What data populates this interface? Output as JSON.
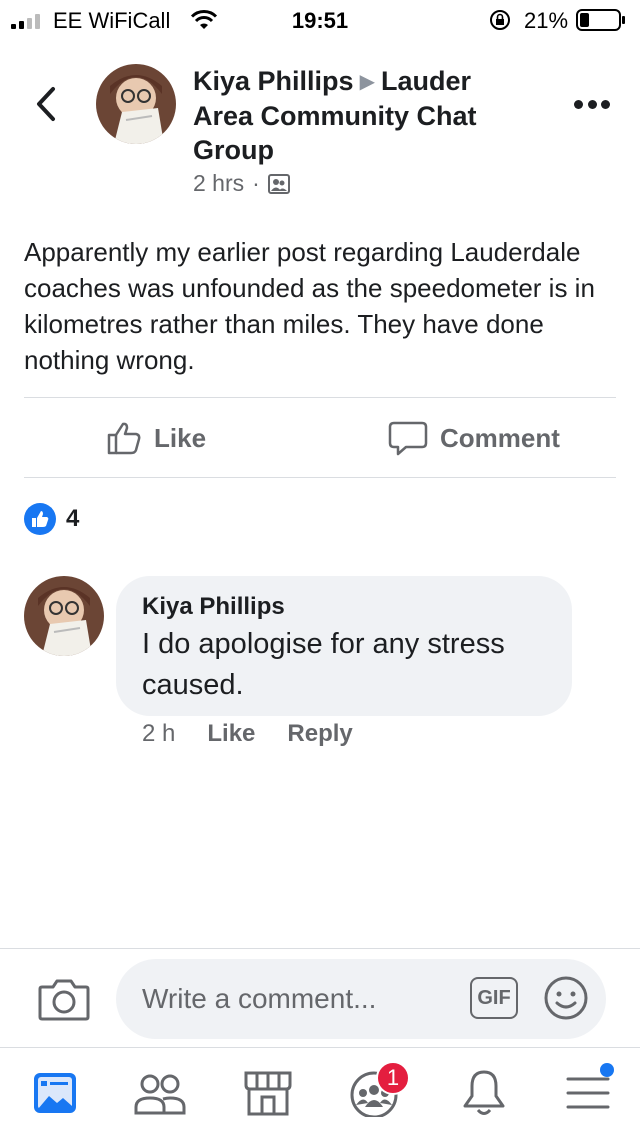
{
  "status_bar": {
    "carrier": "EE WiFiCall",
    "time": "19:51",
    "battery": "21%"
  },
  "post": {
    "author": "Kiya Phillips",
    "group": "Lauder Area Community Chat Group",
    "time": "2 hrs",
    "privacy_icon": "group-members-icon",
    "body": "Apparently my earlier post regarding Lauderdale coaches was unfounded as the speedometer is in kilometres rather than miles. They have done nothing wrong."
  },
  "actions": {
    "like_label": "Like",
    "comment_label": "Comment"
  },
  "reactions": {
    "count": "4"
  },
  "comment": {
    "author": "Kiya Phillips",
    "text": "I do apologise for any stress caused.",
    "time": "2 h",
    "like_label": "Like",
    "reply_label": "Reply"
  },
  "composer": {
    "placeholder": "Write a comment...",
    "gif_label": "GIF"
  },
  "tabbar": {
    "groups_badge": "1",
    "tabs": [
      "news-feed-icon",
      "friends-icon",
      "marketplace-icon",
      "groups-icon",
      "notifications-icon",
      "menu-icon"
    ]
  },
  "colors": {
    "accent": "#1877f2",
    "badge": "#e41e3f",
    "secondary_text": "#65676b",
    "bubble": "#f0f2f5"
  }
}
